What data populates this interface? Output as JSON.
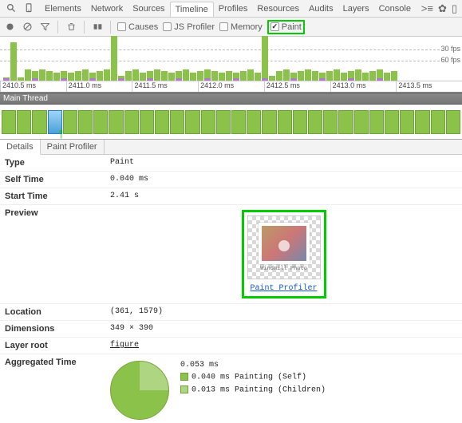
{
  "topTabs": [
    {
      "label": "Elements"
    },
    {
      "label": "Network"
    },
    {
      "label": "Sources"
    },
    {
      "label": "Timeline",
      "active": true
    },
    {
      "label": "Profiles"
    },
    {
      "label": "Resources"
    },
    {
      "label": "Audits"
    },
    {
      "label": "Layers"
    },
    {
      "label": "Console"
    }
  ],
  "toolbarCheckboxes": {
    "causes": "Causes",
    "jsprofiler": "JS Profiler",
    "memory": "Memory",
    "paint": "Paint"
  },
  "fps": {
    "top": "30 fps",
    "bottom": "60 fps"
  },
  "axisTicks": [
    "2410.5 ms",
    "2411.0 ms",
    "2411.5 ms",
    "2412.0 ms",
    "2412.5 ms",
    "2413.0 ms",
    "2413.5 ms"
  ],
  "mainThreadLabel": "Main Thread",
  "detailTabs": [
    {
      "label": "Details",
      "active": true
    },
    {
      "label": "Paint Profiler"
    }
  ],
  "props": {
    "Type": "Paint",
    "SelfTime": "0.040 ms",
    "StartTime": "2.41 s",
    "Location": "(361, 1579)",
    "Dimensions": "349 × 390",
    "LayerRoot": "figure"
  },
  "propLabels": {
    "Type": "Type",
    "SelfTime": "Self Time",
    "StartTime": "Start Time",
    "Preview": "Preview",
    "Location": "Location",
    "Dimensions": "Dimensions",
    "LayerRoot": "Layer root",
    "Aggregated": "Aggregated Time"
  },
  "preview": {
    "caption": "Windmill Photo",
    "link": "Paint Profiler"
  },
  "aggregated": {
    "total": "0.053 ms",
    "self": {
      "color": "#8bc34a",
      "text": "0.040 ms Painting (Self)"
    },
    "children": {
      "color": "#aed581",
      "text": "0.013 ms Painting (Children)"
    }
  }
}
